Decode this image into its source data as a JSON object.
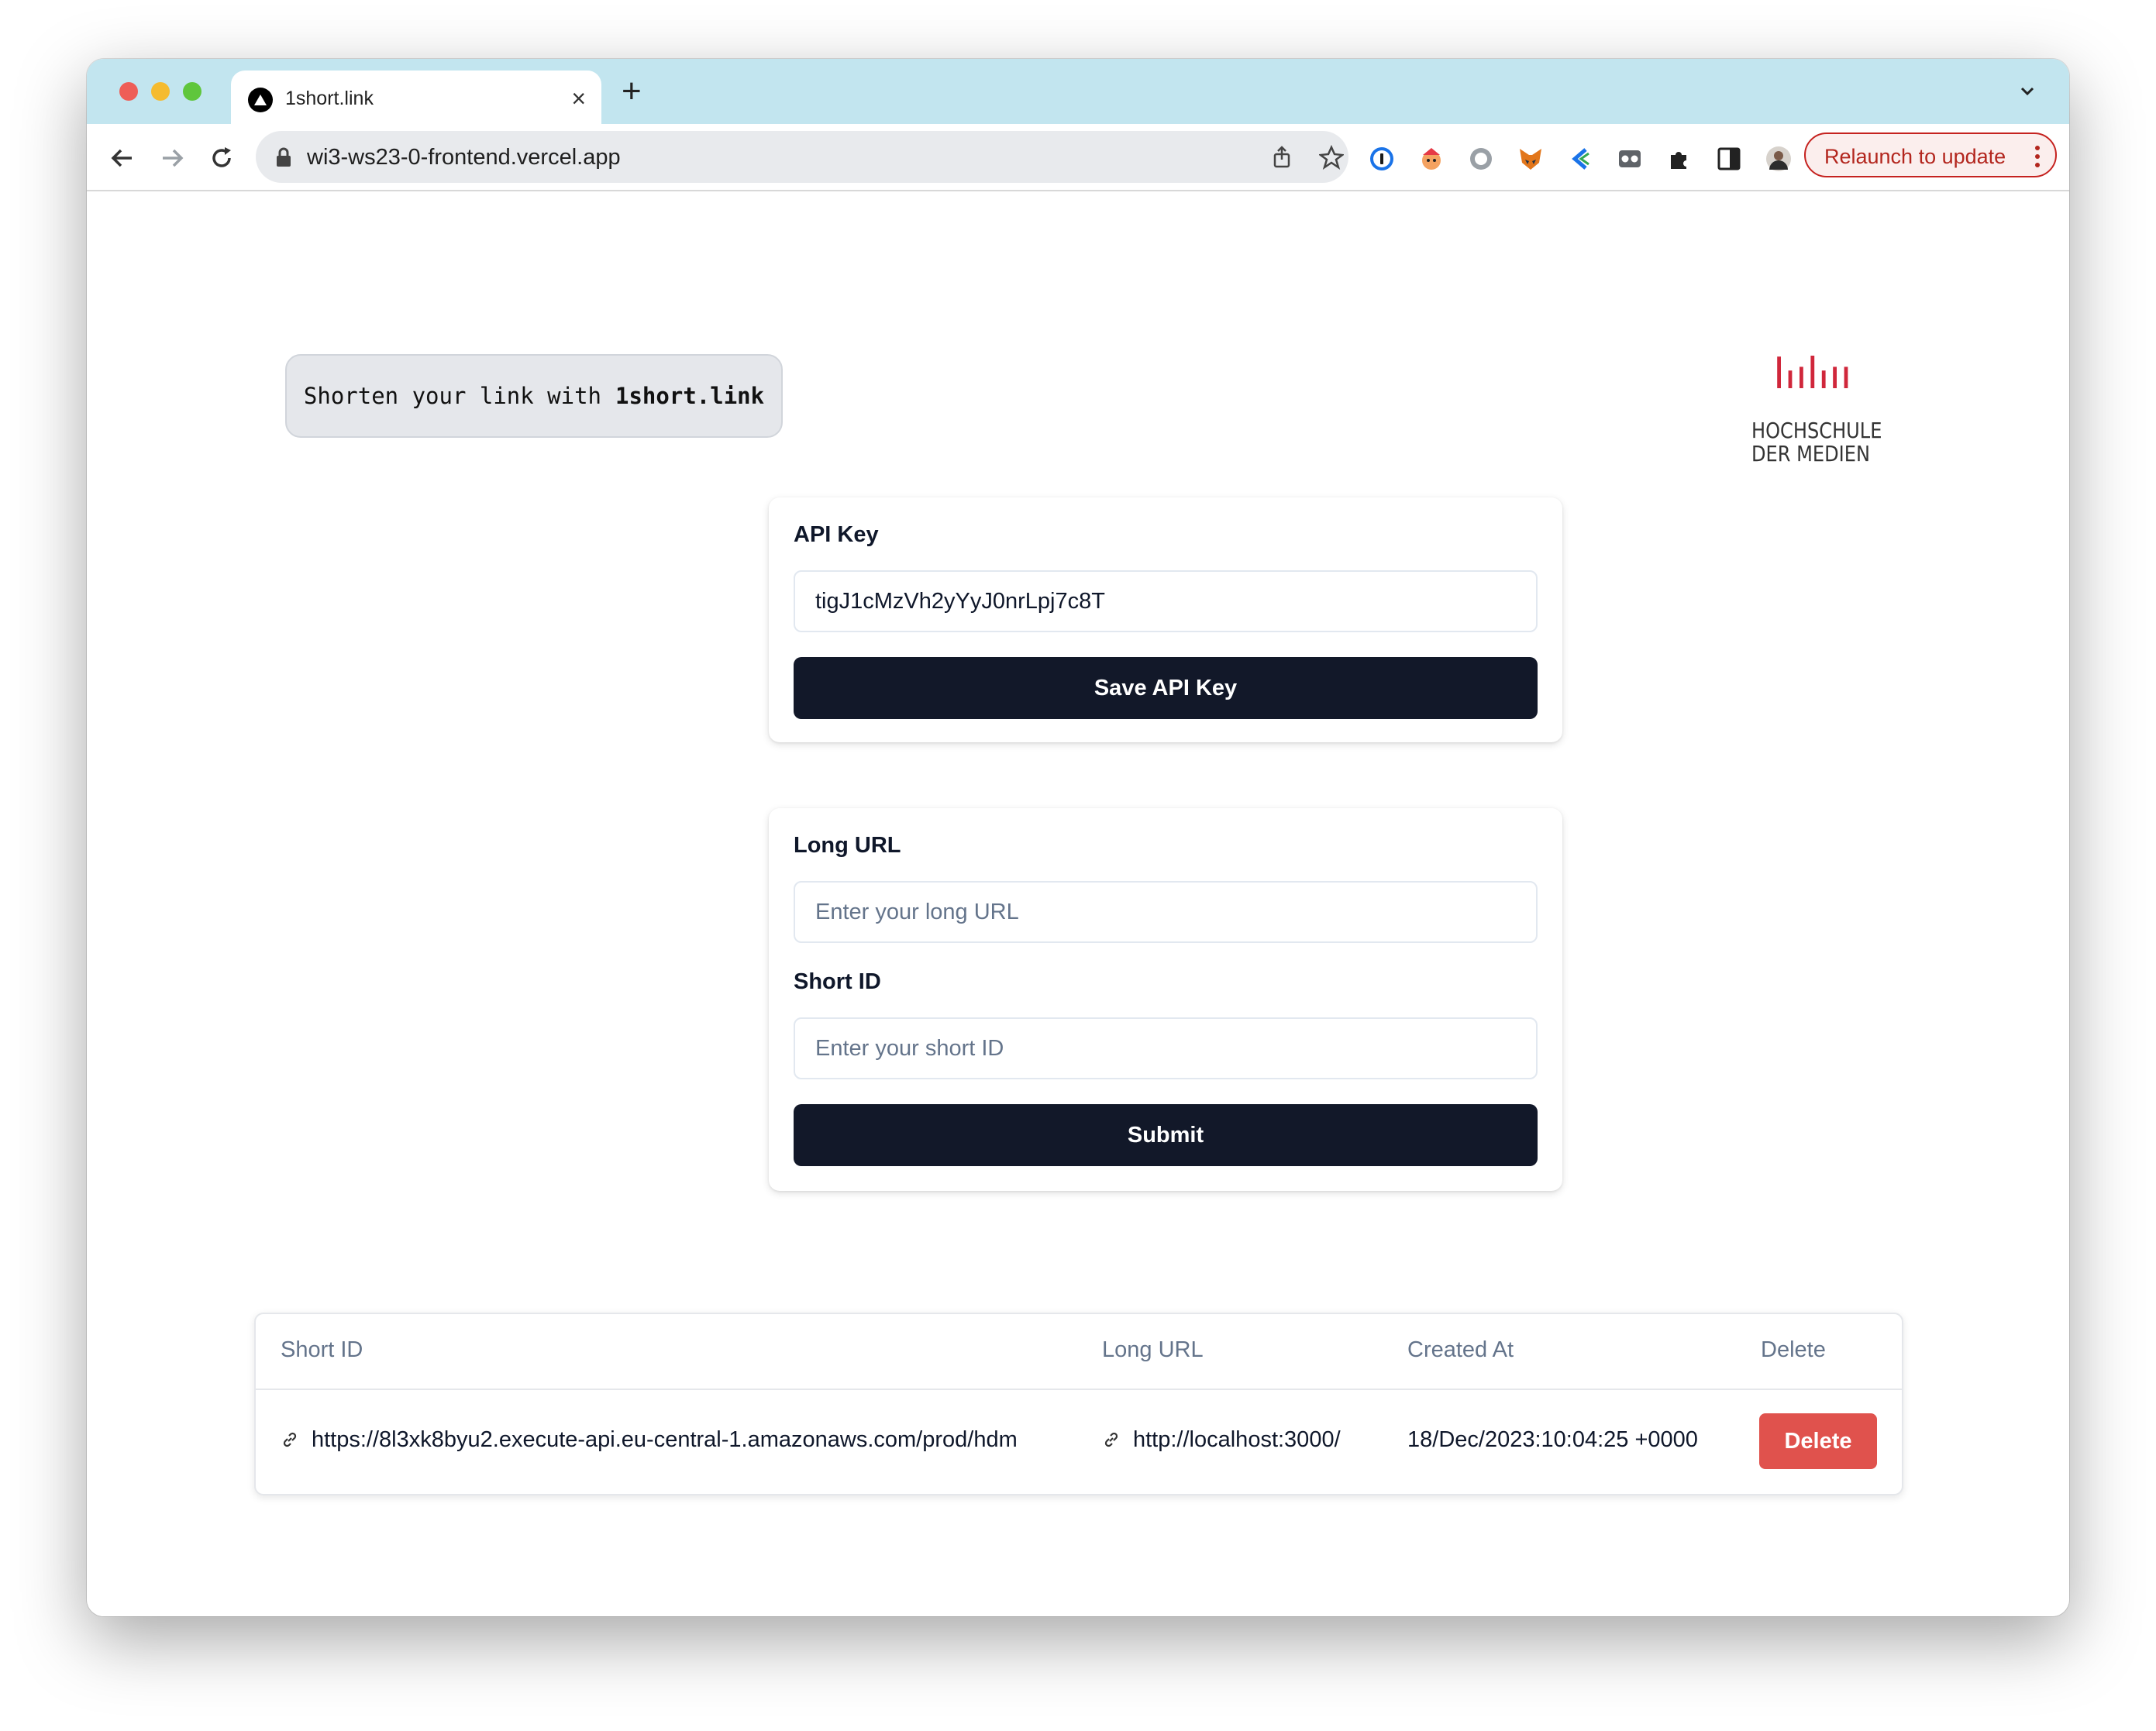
{
  "browser": {
    "tab_title": "1short.link",
    "url": "wi3-ws23-0-frontend.vercel.app",
    "relaunch_label": "Relaunch to update",
    "accent_color": "#c2e5ef",
    "extensions": [
      "1password-icon",
      "game-extension-icon",
      "circle-extension-icon",
      "metamask-fox-icon",
      "bookmark-arrow-extension-icon",
      "glasses-extension-icon",
      "puzzle-icon",
      "sidepanel-icon",
      "profile-avatar"
    ]
  },
  "header": {
    "tagline_prefix": "Shorten your link with",
    "tagline_brand": "1short.link",
    "logo_line1": "HOCHSCHULE",
    "logo_line2": "DER MEDIEN",
    "logo_color": "#d0273b"
  },
  "api_key_form": {
    "label": "API Key",
    "value": "tigJ1cMzVh2yYyJ0nrLpj7c8T",
    "save_label": "Save API Key"
  },
  "shorten_form": {
    "long_url_label": "Long URL",
    "long_url_placeholder": "Enter your long URL",
    "short_id_label": "Short ID",
    "short_id_placeholder": "Enter your short ID",
    "submit_label": "Submit"
  },
  "links_table": {
    "columns": [
      "Short ID",
      "Long URL",
      "Created At",
      "Delete"
    ],
    "rows": [
      {
        "short_id": "https://8l3xk8byu2.execute-api.eu-central-1.amazonaws.com/prod/hdm",
        "long_url": "http://localhost:3000/",
        "created_at": "18/Dec/2023:10:04:25 +0000",
        "delete_label": "Delete"
      }
    ],
    "delete_color": "#e0524d"
  }
}
